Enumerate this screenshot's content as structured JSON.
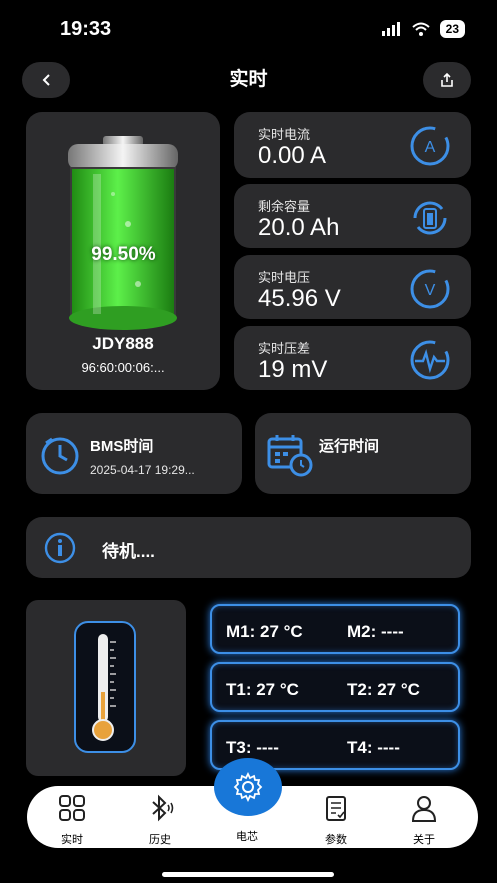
{
  "status_bar": {
    "time": "19:33",
    "battery": "23"
  },
  "header": {
    "title": "实时"
  },
  "battery": {
    "percent": "99.50%",
    "device_name": "JDY888",
    "device_id": "96:60:00:06:..."
  },
  "metrics": [
    {
      "label": "实时电流",
      "value": "0.00 A",
      "icon": "ammeter-icon"
    },
    {
      "label": "剩余容量",
      "value": "20.0 Ah",
      "icon": "battery-refresh-icon"
    },
    {
      "label": "实时电压",
      "value": "45.96 V",
      "icon": "voltmeter-icon"
    },
    {
      "label": "实时压差",
      "value": "19 mV",
      "icon": "pulse-icon"
    }
  ],
  "bms_time": {
    "title": "BMS时间",
    "value": "2025-04-17 19:29..."
  },
  "run_time": {
    "title": "运行时间"
  },
  "status": {
    "text": "待机...."
  },
  "temps": {
    "m1": "M1:  27 °C",
    "m2": "M2: ----",
    "t1": "T1:  27 °C",
    "t2": "T2: 27 °C",
    "t3": "T3: ----",
    "t4": "T4: ----"
  },
  "tabs": [
    {
      "label": "实时",
      "icon": "grid-icon"
    },
    {
      "label": "历史",
      "icon": "bluetooth-icon"
    },
    {
      "label": "电芯",
      "icon": "gear-icon"
    },
    {
      "label": "参数",
      "icon": "clipboard-icon"
    },
    {
      "label": "关于",
      "icon": "person-icon"
    }
  ],
  "colors": {
    "accent": "#3d8fe6",
    "card": "#2b2b2d",
    "battery_green": "#39d12b"
  }
}
